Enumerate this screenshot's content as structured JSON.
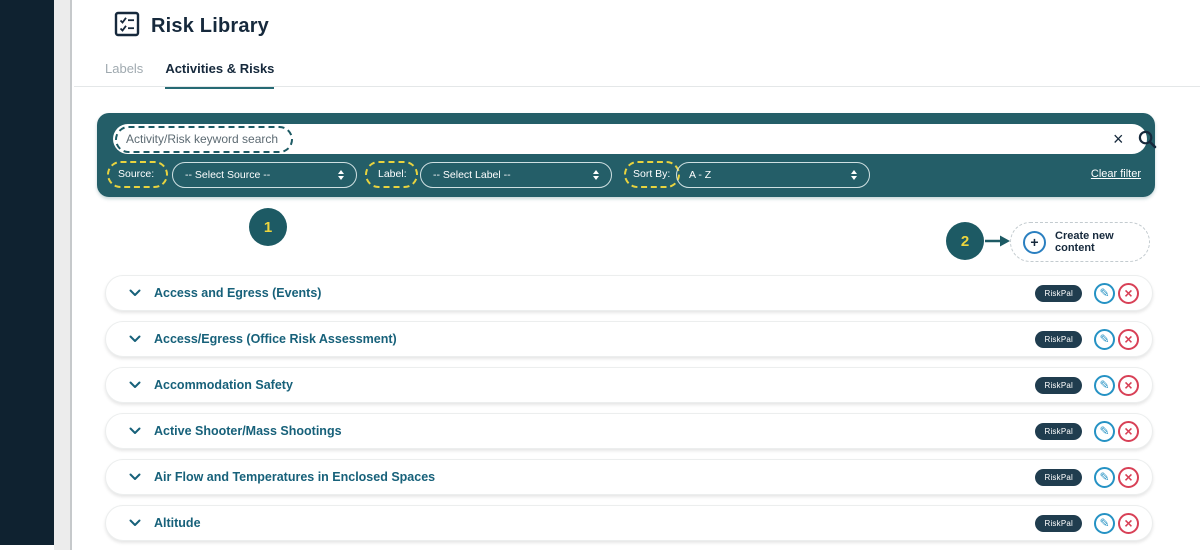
{
  "app": {
    "title": "Risk Library"
  },
  "tabs": [
    {
      "label": "Labels",
      "active": false
    },
    {
      "label": "Activities & Risks",
      "active": true
    }
  ],
  "search_panel": {
    "search_placeholder": "Activity/Risk keyword search",
    "clear_filter_label": "Clear filter",
    "filters": [
      {
        "label": "Source:",
        "value": "-- Select Source --"
      },
      {
        "label": "Label:",
        "value": "-- Select Label --"
      },
      {
        "label": "Sort By:",
        "value": "A - Z"
      }
    ]
  },
  "annotations": {
    "step_one": "1",
    "step_two": "2"
  },
  "create_button": {
    "label": "Create new content"
  },
  "risk_rows": [
    {
      "title": "Access and Egress (Events)",
      "badge": "RiskPal"
    },
    {
      "title": "Access/Egress (Office Risk Assessment)",
      "badge": "RiskPal"
    },
    {
      "title": "Accommodation Safety",
      "badge": "RiskPal"
    },
    {
      "title": "Active Shooter/Mass Shootings",
      "badge": "RiskPal"
    },
    {
      "title": "Air Flow and Temperatures in Enclosed Spaces",
      "badge": "RiskPal"
    },
    {
      "title": "Altitude",
      "badge": "RiskPal"
    }
  ],
  "icons": {
    "close": "×",
    "plus": "+",
    "edit_pencil": "✎",
    "delete_x": "×"
  },
  "colors": {
    "sidebar_navy": "#0f2230",
    "panel_teal": "#245e68",
    "annotation_teal": "#1d5a64",
    "annotation_yellow": "#e8d33f",
    "heading_navy": "#16293c",
    "row_title_teal": "#17617a",
    "badge_navy": "#203d4f",
    "edit_blue": "#2592c4",
    "delete_red": "#d84056"
  }
}
